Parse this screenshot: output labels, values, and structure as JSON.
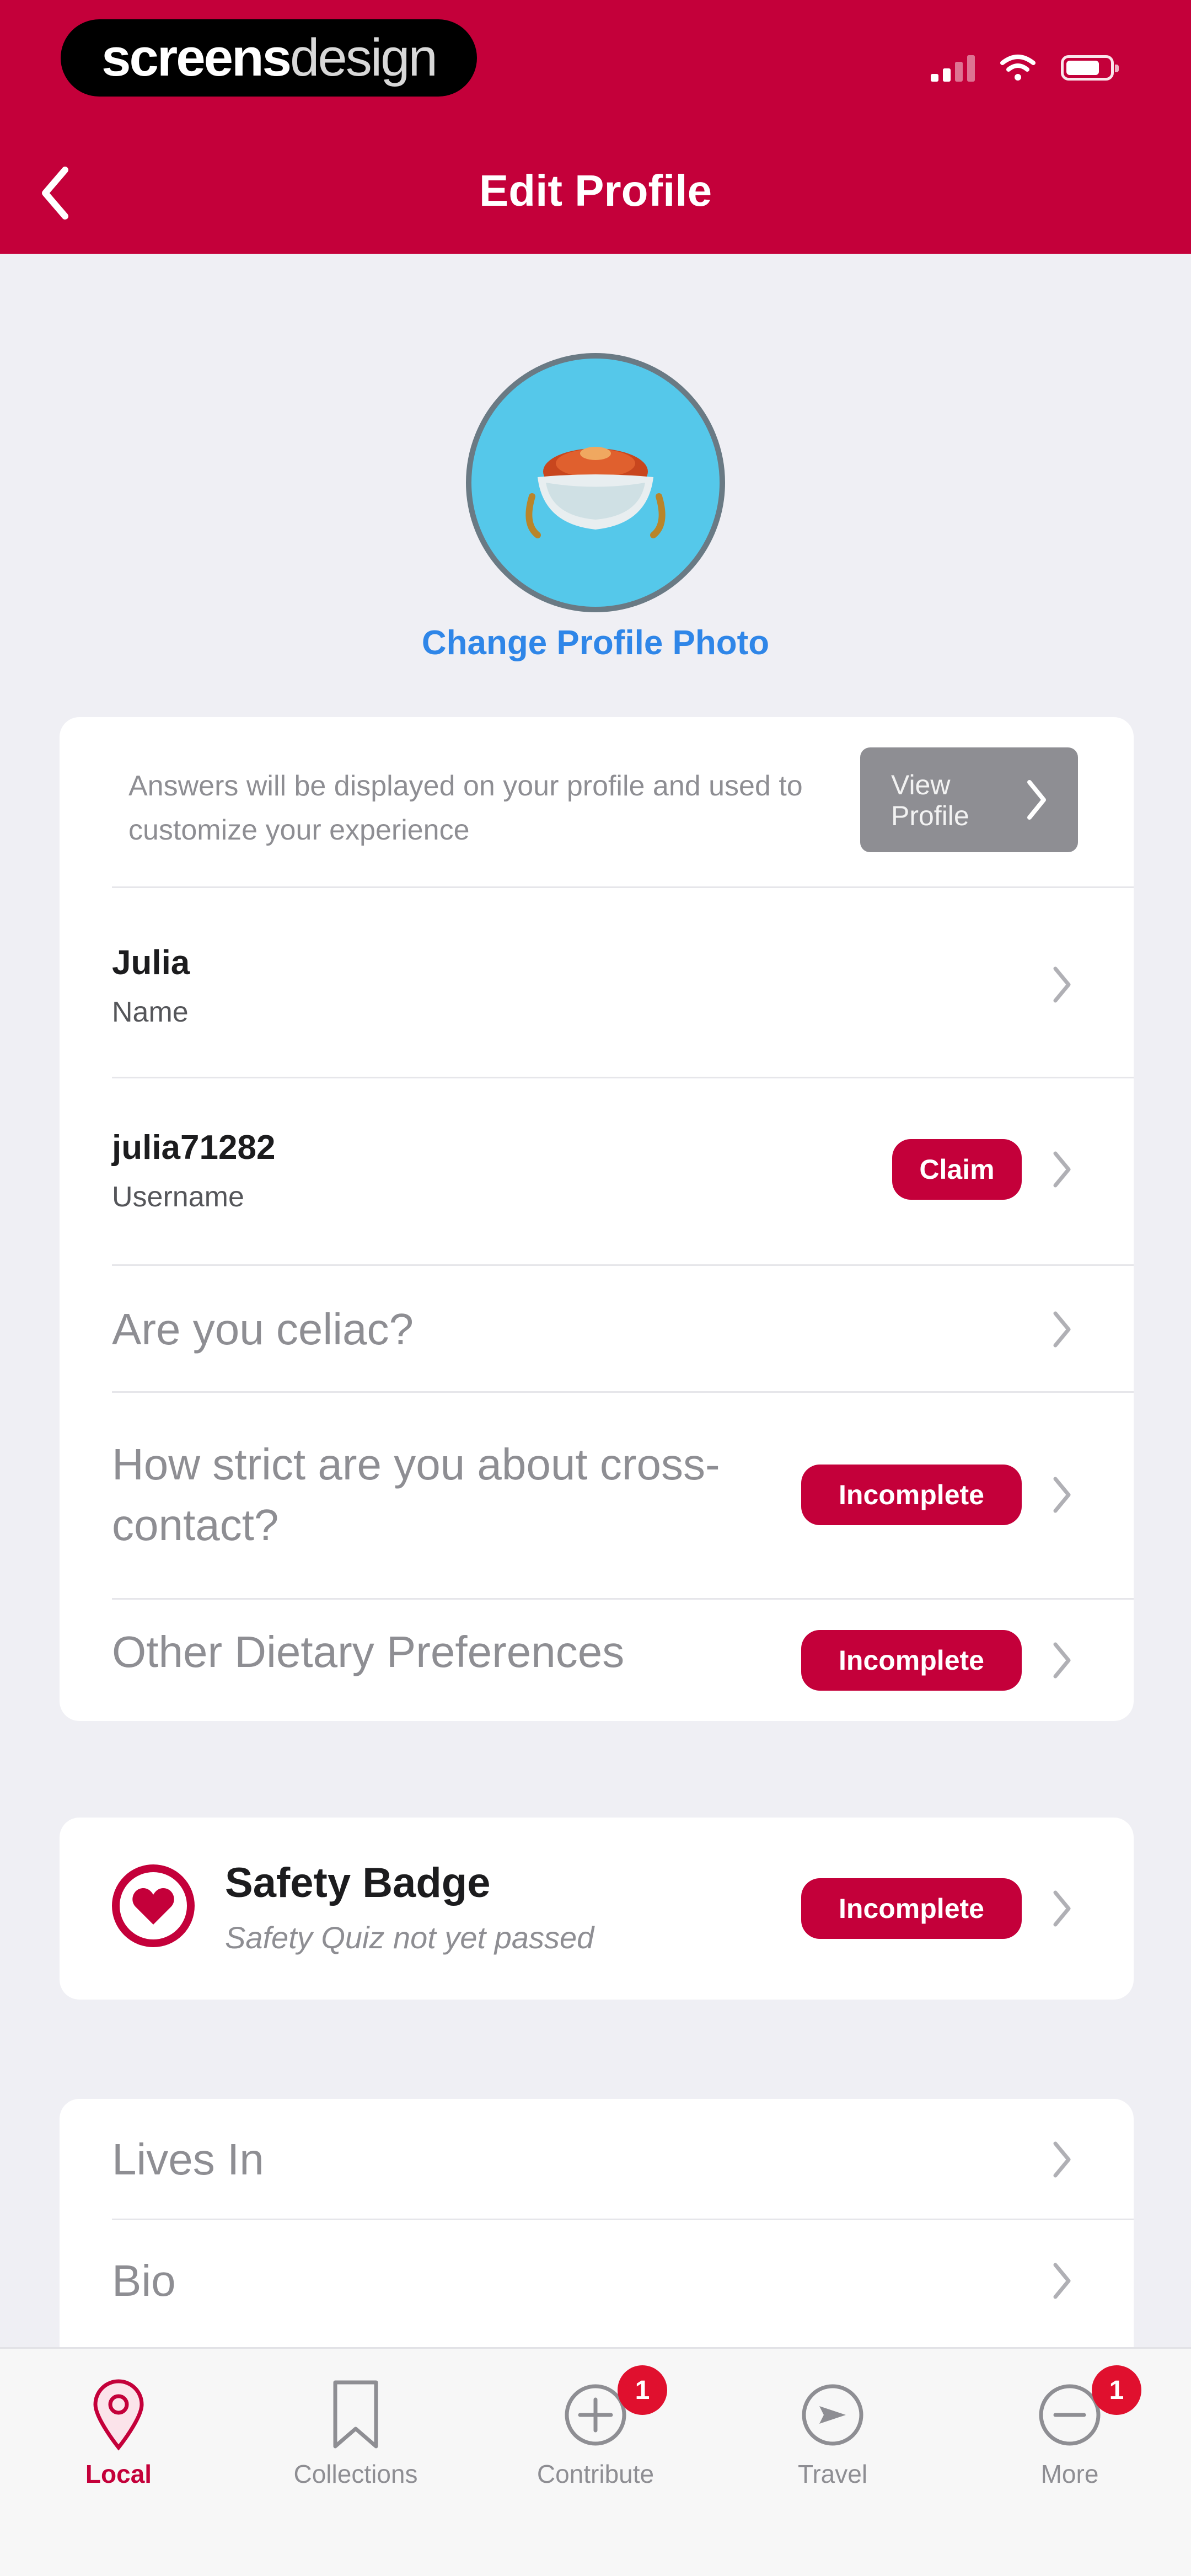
{
  "watermark": {
    "bold": "screens",
    "light": "design"
  },
  "header": {
    "title": "Edit Profile"
  },
  "profile": {
    "change_photo_label": "Change Profile Photo"
  },
  "info_card": {
    "hint": "Answers will be displayed on your profile and used to customize your experience",
    "view_profile_label": "View Profile"
  },
  "fields": {
    "name": {
      "value": "Julia",
      "label": "Name"
    },
    "username": {
      "value": "julia71282",
      "label": "Username",
      "badge": "Claim"
    },
    "celiac": {
      "question": "Are you celiac?"
    },
    "cross_contact": {
      "question": "How strict are you about cross-contact?",
      "badge": "Incomplete"
    },
    "dietary": {
      "question": "Other Dietary Preferences",
      "badge": "Incomplete"
    }
  },
  "safety": {
    "title": "Safety Badge",
    "subtitle": "Safety Quiz not yet passed",
    "badge": "Incomplete"
  },
  "more_fields": {
    "lives_in": "Lives In",
    "bio": "Bio"
  },
  "tabbar": {
    "tabs": [
      {
        "label": "Local",
        "icon": "location-pin-icon",
        "active": true
      },
      {
        "label": "Collections",
        "icon": "bookmark-icon"
      },
      {
        "label": "Contribute",
        "icon": "plus-circle-icon",
        "notification": "1"
      },
      {
        "label": "Travel",
        "icon": "airplane-circle-icon"
      },
      {
        "label": "More",
        "icon": "more-circle-icon",
        "notification": "1"
      }
    ]
  },
  "colors": {
    "brand": "#c4003a",
    "link": "#2f86e8",
    "avatar_bg": "#55c8ea"
  }
}
